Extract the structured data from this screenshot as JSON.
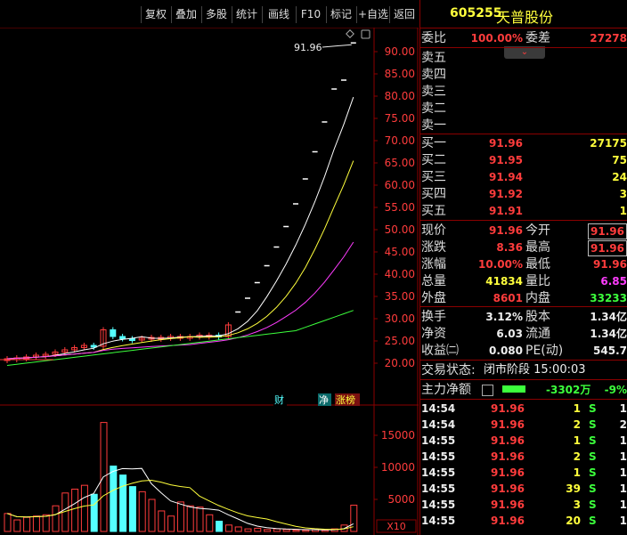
{
  "toolbar": {
    "buttons": [
      "复权",
      "叠加",
      "多股",
      "统计",
      "画线",
      "F10",
      "标记",
      "+自选",
      "返回"
    ]
  },
  "price_axis": [
    "90.00",
    "85.00",
    "80.00",
    "75.00",
    "70.00",
    "65.00",
    "60.00",
    "55.00",
    "50.00",
    "45.00",
    "40.00",
    "35.00",
    "30.00",
    "25.00",
    "20.00"
  ],
  "volume_axis": [
    "15000",
    "10000",
    "5000"
  ],
  "volume_unit": "X10",
  "peak_label": "91.96",
  "chart_markers": {
    "cai": "财",
    "jing": "净",
    "zhangbang": "涨榜"
  },
  "stock": {
    "code": "605255",
    "name": "天普股份"
  },
  "weibi": {
    "label": "委比",
    "value": "100.00%",
    "label2": "委差",
    "value2": "27278"
  },
  "sell": [
    {
      "label": "卖五"
    },
    {
      "label": "卖四"
    },
    {
      "label": "卖三"
    },
    {
      "label": "卖二"
    },
    {
      "label": "卖一"
    }
  ],
  "buy": [
    {
      "label": "买一",
      "price": "91.96",
      "vol": "27175"
    },
    {
      "label": "买二",
      "price": "91.95",
      "vol": "75"
    },
    {
      "label": "买三",
      "price": "91.94",
      "vol": "24"
    },
    {
      "label": "买四",
      "price": "91.92",
      "vol": "3"
    },
    {
      "label": "买五",
      "price": "91.91",
      "vol": "1"
    }
  ],
  "quote": [
    {
      "l1": "现价",
      "v1": "91.96",
      "c1": "red",
      "l2": "今开",
      "v2": "91.96",
      "c2": "red",
      "box": true
    },
    {
      "l1": "涨跌",
      "v1": "8.36",
      "c1": "red",
      "l2": "最高",
      "v2": "91.96",
      "c2": "red",
      "box": true
    },
    {
      "l1": "涨幅",
      "v1": "10.00%",
      "c1": "red",
      "l2": "最低",
      "v2": "91.96",
      "c2": "red",
      "box": false
    },
    {
      "l1": "总量",
      "v1": "41834",
      "c1": "yellow",
      "l2": "量比",
      "v2": "6.85",
      "c2": "magenta",
      "box": false
    },
    {
      "l1": "外盘",
      "v1": "8601",
      "c1": "red",
      "l2": "内盘",
      "v2": "33233",
      "c2": "green",
      "box": false
    }
  ],
  "stats": [
    {
      "l1": "换手",
      "v1": "3.12%",
      "l2": "股本",
      "v2": "1.34亿"
    },
    {
      "l1": "净资",
      "v1": "6.03",
      "l2": "流通",
      "v2": "1.34亿"
    },
    {
      "l1": "收益㈡",
      "v1": "0.080",
      "l2": "PE(动)",
      "v2": "545.7"
    }
  ],
  "status": {
    "label": "交易状态:",
    "value": "闭市阶段 15:00:03"
  },
  "mainflow": {
    "label": "主力净额",
    "value": "-3302万",
    "pct": "-9%"
  },
  "ticks": [
    {
      "time": "14:54",
      "price": "91.96",
      "vol": "1",
      "bs": "S",
      "n": "1"
    },
    {
      "time": "14:54",
      "price": "91.96",
      "vol": "2",
      "bs": "S",
      "n": "2"
    },
    {
      "time": "14:55",
      "price": "91.96",
      "vol": "1",
      "bs": "S",
      "n": "1"
    },
    {
      "time": "14:55",
      "price": "91.96",
      "vol": "2",
      "bs": "S",
      "n": "1"
    },
    {
      "time": "14:55",
      "price": "91.96",
      "vol": "1",
      "bs": "S",
      "n": "1"
    },
    {
      "time": "14:55",
      "price": "91.96",
      "vol": "39",
      "bs": "S",
      "n": "1"
    },
    {
      "time": "14:55",
      "price": "91.96",
      "vol": "3",
      "bs": "S",
      "n": "1"
    },
    {
      "time": "14:55",
      "price": "91.96",
      "vol": "20",
      "bs": "S",
      "n": "1"
    }
  ],
  "colors": {
    "up": "#ff3c3c",
    "down": "#54ffff",
    "ma5": "#ffffff",
    "ma10": "#ffff3c",
    "ma20": "#ff3cff",
    "ma60": "#3cff3c",
    "border": "#8b0000"
  },
  "chart_data": {
    "type": "candlestick",
    "note": "Daily K-line with moving averages; last ~11 sessions consecutive limit-up (one-price) bars.",
    "closes": [
      21.0,
      21.2,
      21.4,
      21.8,
      22.0,
      22.5,
      23.0,
      23.5,
      24.0,
      23.8,
      27.5,
      26.0,
      25.5,
      25.2,
      25.6,
      25.8,
      25.8,
      26.0,
      26.0,
      26.0,
      26.3,
      26.3,
      26.0,
      28.6,
      31.5,
      34.6,
      38.1,
      41.9,
      46.1,
      50.7,
      55.8,
      61.4,
      67.5,
      74.2,
      81.6,
      83.6,
      91.96
    ],
    "volumes": [
      2800,
      1800,
      2200,
      2400,
      2600,
      4000,
      6000,
      6600,
      7200,
      5800,
      17000,
      10200,
      8800,
      7000,
      6200,
      5000,
      3200,
      2400,
      4600,
      4000,
      3800,
      2600,
      1600,
      1000,
      700,
      400,
      500,
      300,
      400,
      300,
      200,
      200,
      300,
      200,
      400,
      1000,
      4100
    ],
    "price_range": [
      20.0,
      90.0
    ],
    "volume_range": [
      0,
      17500
    ]
  }
}
